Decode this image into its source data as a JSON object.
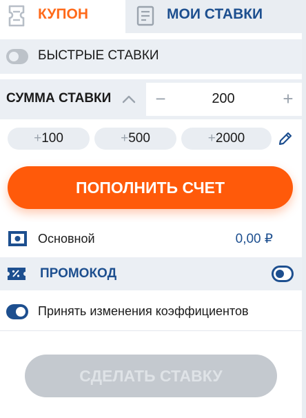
{
  "tabs": {
    "coupon": {
      "label": "КУПОН",
      "icon": "coupon-icon",
      "active": true
    },
    "my_bets": {
      "label": "МОИ СТАВКИ",
      "icon": "bets-list-icon",
      "active": false
    }
  },
  "quick_bets": {
    "label": "БЫСТРЫЕ СТАВКИ",
    "enabled": false
  },
  "stake": {
    "label": "СУММА СТАВКИ",
    "value": "200",
    "minus": "−",
    "plus": "+"
  },
  "quick_amounts": [
    {
      "sign": "+",
      "value": "100"
    },
    {
      "sign": "+",
      "value": "500"
    },
    {
      "sign": "+",
      "value": "2000"
    }
  ],
  "top_up": {
    "label": "ПОПОЛНИТЬ СЧЕТ"
  },
  "account": {
    "label": "Основной",
    "balance": "0,00 ₽"
  },
  "promo": {
    "label": "ПРОМОКОД"
  },
  "accept_changes": {
    "label": "Принять изменения коэффициентов",
    "enabled": true
  },
  "place_bet": {
    "label": "СДЕЛАТЬ СТАВКУ",
    "disabled": true
  },
  "colors": {
    "accent_orange": "#ff5a0a",
    "brand_blue": "#1d4f8f",
    "panel_gray": "#ebeff4",
    "disabled_gray": "#c4c9cf"
  }
}
